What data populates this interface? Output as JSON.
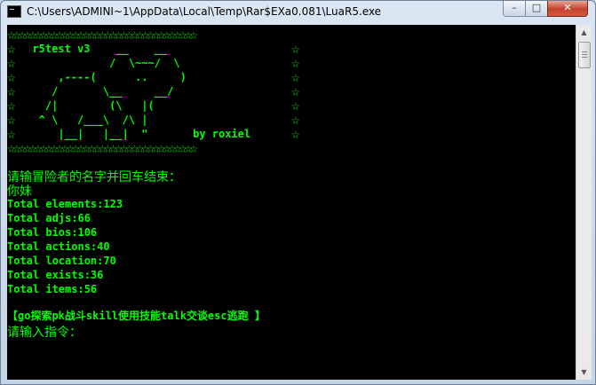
{
  "window": {
    "title": "C:\\Users\\ADMINI~1\\AppData\\Local\\Temp\\Rar$EXa0.081\\LuaR5.exe",
    "min_label": "–",
    "max_label": "□",
    "close_label": "✕"
  },
  "console": {
    "banner": {
      "border_left": "☆",
      "border_right": "☆",
      "star_row": "☆☆☆☆☆☆☆☆☆☆☆☆☆☆☆☆☆☆☆☆☆☆☆☆☆☆☆☆☆☆☆☆☆☆☆",
      "art_lines": [
        "  r5test v3    __    __",
        "              /  \\~~~/  \\",
        "      ,----(      ..     )",
        "     /       \\__     __/",
        "    /|        (\\   |(",
        "   ^ \\   /___\\  /\\ |",
        "      |__|   |__|  \"       by roxiel"
      ]
    },
    "prompt_name": "请输冒险者的名字并回车结束：",
    "entered_name": "你妹",
    "stats": [
      "Total elements:123",
      "Total adjs:66",
      "Total bios:106",
      "Total actions:40",
      "Total location:70",
      "Total exists:36",
      "Total items:56"
    ],
    "commands": "【go探索pk战斗skill使用技能talk交谈esc逃跑 】",
    "prompt_command": "请输入指令："
  },
  "colors": {
    "console_bg": "#000000",
    "console_text": "#00ff00"
  }
}
